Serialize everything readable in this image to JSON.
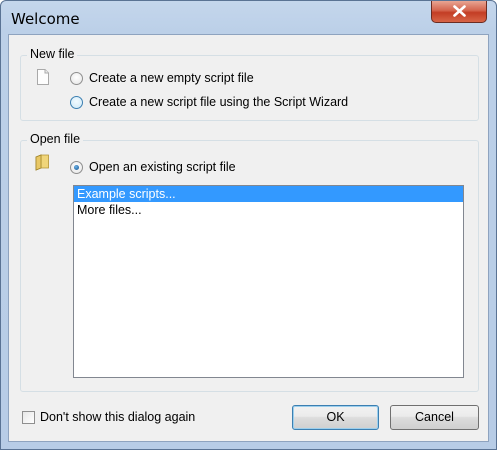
{
  "window": {
    "title": "Welcome"
  },
  "new_file": {
    "legend": "New file",
    "options": [
      {
        "label": "Create a new empty script file",
        "checked": false
      },
      {
        "label": "Create a new script file using the Script Wizard",
        "checked": false
      }
    ]
  },
  "open_file": {
    "legend": "Open file",
    "option": {
      "label": "Open an existing script file",
      "checked": true
    },
    "list": [
      {
        "label": "Example scripts...",
        "selected": true
      },
      {
        "label": "More files...",
        "selected": false
      }
    ]
  },
  "footer": {
    "dont_show_label": "Don't show this dialog again",
    "ok_label": "OK",
    "cancel_label": "Cancel"
  },
  "colors": {
    "selection": "#3399ff",
    "close_button": "#c74a33"
  }
}
